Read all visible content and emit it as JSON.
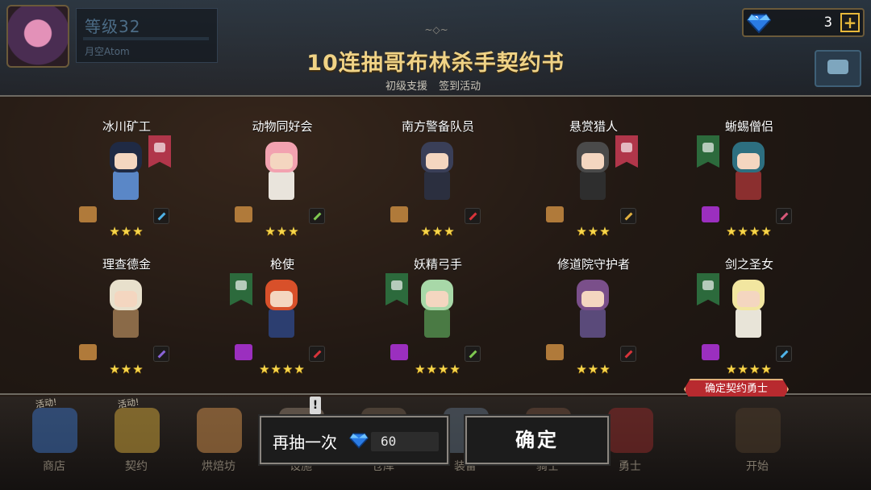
{
  "player": {
    "level": "等级32",
    "name": "月空Atom"
  },
  "currency": {
    "gems": "3",
    "plus_symbol": "+"
  },
  "header": {
    "ornament": "~◇~",
    "title": "10连抽哥布林杀手契约书",
    "subtabs": [
      "初级支援",
      "签到活动"
    ]
  },
  "heroes": [
    {
      "name": "冰川矿工",
      "stars": "★★★",
      "class_color": "#b0364a",
      "scroll_color": "#b07a3a",
      "weapon_color": "#4fb3e8",
      "hair": "#1f2a44",
      "outfit": "#5a87c7"
    },
    {
      "name": "动物同好会",
      "stars": "★★★",
      "class_color": "",
      "scroll_color": "#b07a3a",
      "weapon_color": "#7ec850",
      "hair": "#f2a2b0",
      "outfit": "#e9e4dc"
    },
    {
      "name": "南方警备队员",
      "stars": "★★★",
      "class_color": "",
      "scroll_color": "#b07a3a",
      "weapon_color": "#d8343a",
      "hair": "#3a3f58",
      "outfit": "#2b2f3f"
    },
    {
      "name": "悬赏猎人",
      "stars": "★★★",
      "class_color": "#b0364a",
      "scroll_color": "#b07a3a",
      "weapon_color": "#e0b040",
      "hair": "#4a4a4a",
      "outfit": "#2e2e2e"
    },
    {
      "name": "蜥蜴僧侣",
      "stars": "★★★★",
      "class_color": "#2c6a3c",
      "scroll_color": "#9b2fbf",
      "weapon_color": "#d8587a",
      "hair": "#2d6f80",
      "outfit": "#8b2f2f"
    },
    {
      "name": "理查德金",
      "stars": "★★★",
      "class_color": "",
      "scroll_color": "#b07a3a",
      "weapon_color": "#8a64d8",
      "hair": "#e8e0cc",
      "outfit": "#8a6a48"
    },
    {
      "name": "枪使",
      "stars": "★★★★",
      "class_color": "#2c6a3c",
      "scroll_color": "#9b2fbf",
      "weapon_color": "#d8343a",
      "hair": "#d8502a",
      "outfit": "#2c3e70"
    },
    {
      "name": "妖精弓手",
      "stars": "★★★★",
      "class_color": "#2c6a3c",
      "scroll_color": "#9b2fbf",
      "weapon_color": "#7ec850",
      "hair": "#a8d8a8",
      "outfit": "#4a7a44"
    },
    {
      "name": "修道院守护者",
      "stars": "★★★",
      "class_color": "",
      "scroll_color": "#b07a3a",
      "weapon_color": "#d8343a",
      "hair": "#7a4f8a",
      "outfit": "#5a4a7a"
    },
    {
      "name": "剑之圣女",
      "stars": "★★★★",
      "class_color": "#2c6a3c",
      "scroll_color": "#9b2fbf",
      "weapon_color": "#4fb3e8",
      "hair": "#f2e6a0",
      "outfit": "#e8e4d8"
    }
  ],
  "confirm_tag": "确定契约勇士",
  "actions": {
    "draw_again": "再抽一次",
    "draw_cost": "60",
    "confirm": "确定"
  },
  "bottom_nav": [
    {
      "label": "商店",
      "activity": "活动!",
      "alert": "",
      "color": "#3b6db8"
    },
    {
      "label": "契约",
      "activity": "活动!",
      "alert": "",
      "color": "#c9a13a"
    },
    {
      "label": "烘焙坊",
      "activity": "",
      "alert": "",
      "color": "#c98a4a"
    },
    {
      "label": "设施",
      "activity": "",
      "alert": "!",
      "color": "#8a7a6a"
    },
    {
      "label": "仓库",
      "activity": "",
      "alert": "",
      "color": "#6a5a48"
    },
    {
      "label": "装备",
      "activity": "",
      "alert": "",
      "color": "#5a6a7a"
    },
    {
      "label": "骑士",
      "activity": "",
      "alert": "",
      "color": "#6a4a3a"
    },
    {
      "label": "勇士",
      "activity": "",
      "alert": "",
      "color": "#8a2a2a"
    },
    {
      "label": "开始",
      "activity": "",
      "alert": "",
      "color": "#4a3a2a"
    }
  ]
}
